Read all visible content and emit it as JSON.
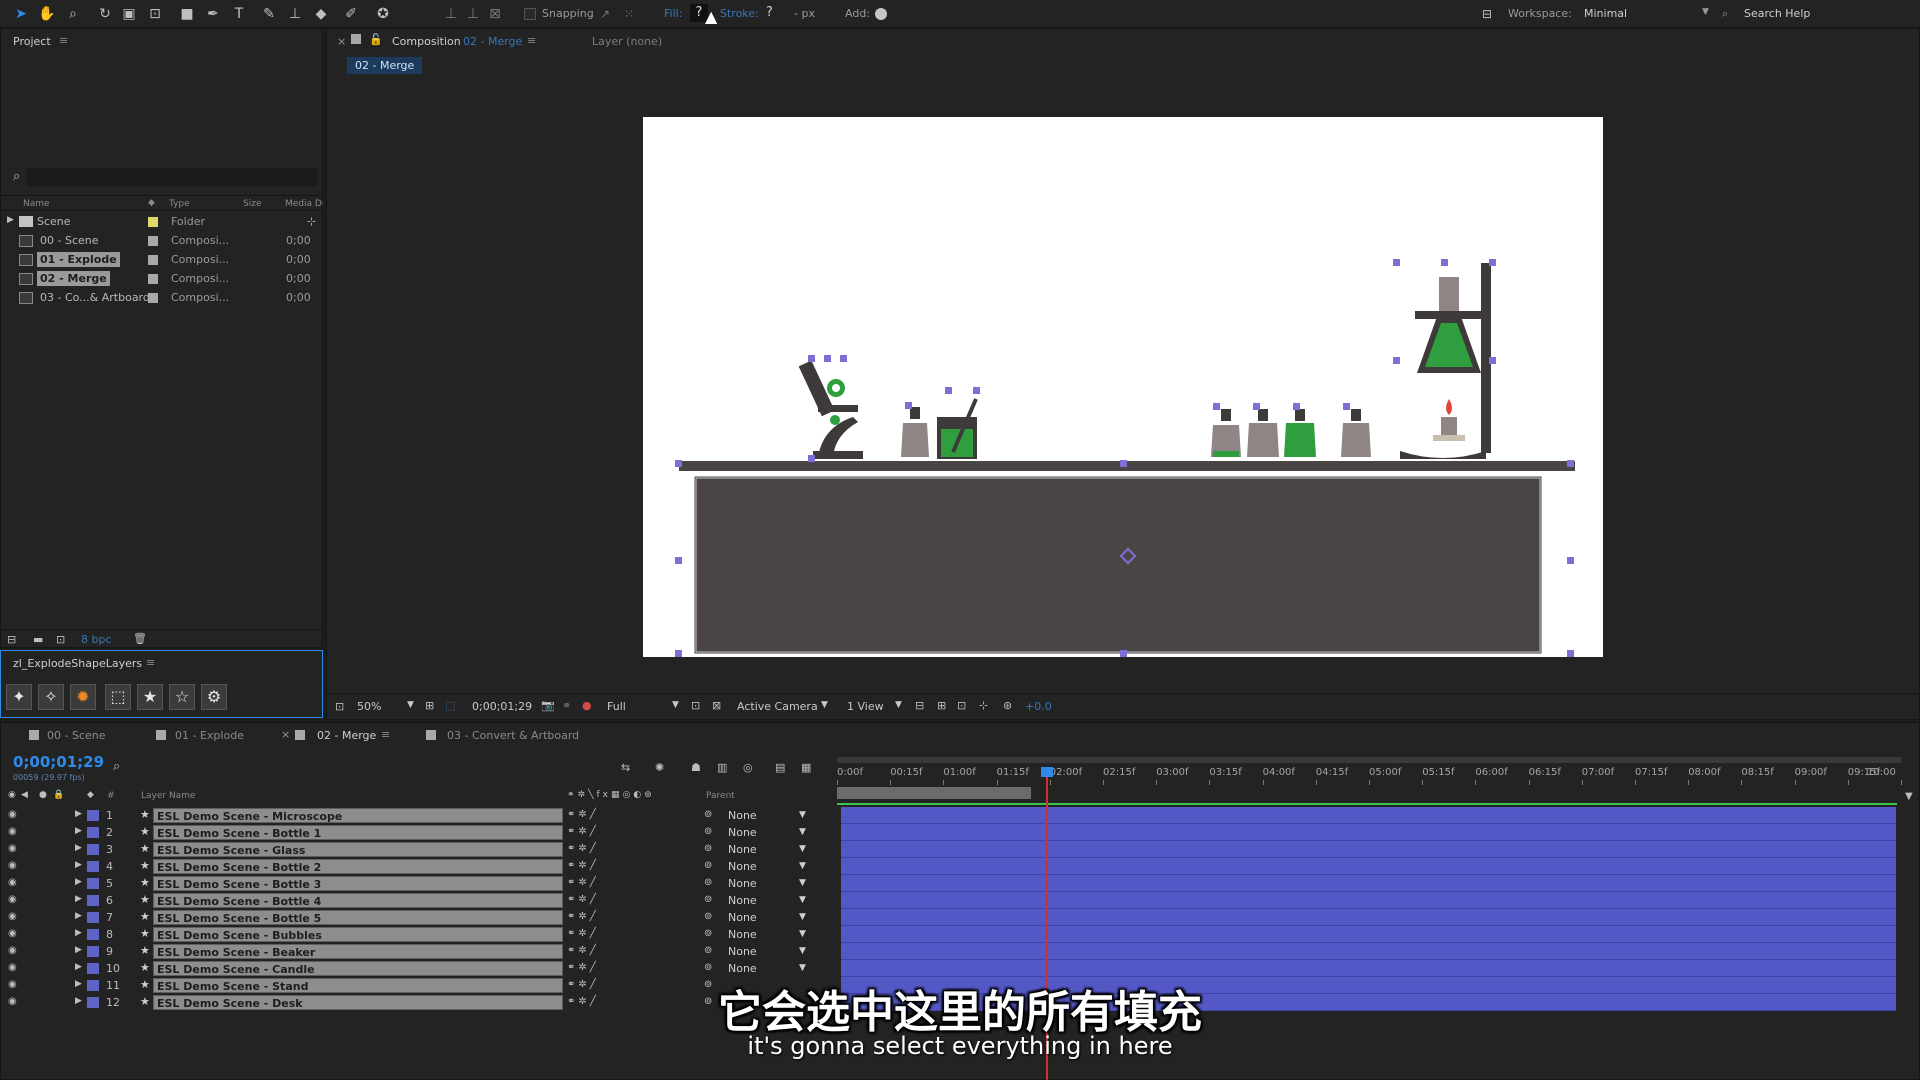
{
  "toolbar": {
    "snapping": "Snapping",
    "fill": "Fill:",
    "fill_value": "?",
    "stroke": "Stroke:",
    "stroke_value": "?",
    "px": "- px",
    "add": "Add:",
    "workspace_label": "Workspace:",
    "workspace_value": "Minimal",
    "search_help": "Search Help"
  },
  "project_panel": {
    "tab": "Project",
    "col_name": "Name",
    "col_type": "Type",
    "col_size": "Size",
    "col_media": "Media Du",
    "items": [
      {
        "name": "Scene",
        "type": "Folder",
        "dur": ""
      },
      {
        "name": "00 - Scene",
        "type": "Composi...",
        "dur": "0;00"
      },
      {
        "name": "01 - Explode",
        "type": "Composi...",
        "dur": "0;00"
      },
      {
        "name": "02 - Merge",
        "type": "Composi...",
        "dur": "0;00"
      },
      {
        "name": "03 - Co...& Artboard",
        "type": "Composi...",
        "dur": "0;00"
      }
    ],
    "bpc": "8 bpc"
  },
  "script_panel": {
    "tab": "zl_ExplodeShapeLayers"
  },
  "composition": {
    "tab_label": "Composition",
    "tab_name": "02 - Merge",
    "layer_tab": "Layer (none)",
    "breadcrumb": "02 - Merge",
    "zoom": "50%",
    "timecode": "0;00;01;29",
    "resolution": "Full",
    "camera": "Active Camera",
    "view": "1 View",
    "exposure": "+0.0"
  },
  "timeline": {
    "tabs": [
      "00 - Scene",
      "01 - Explode",
      "02 - Merge",
      "03 - Convert & Artboard"
    ],
    "timecode": "0;00;01;29",
    "fps": "00059 (29.97 fps)",
    "col_layer_name": "Layer Name",
    "col_parent": "Parent",
    "col_num": "#",
    "ruler": [
      "0:00f",
      "00:15f",
      "01:00f",
      "01:15f",
      "02:00f",
      "02:15f",
      "03:00f",
      "03:15f",
      "04:00f",
      "04:15f",
      "05:00f",
      "05:15f",
      "06:00f",
      "06:15f",
      "07:00f",
      "07:15f",
      "08:00f",
      "08:15f",
      "09:00f",
      "09:15f",
      "10:00"
    ],
    "layers": [
      {
        "num": "1",
        "name": "ESL Demo Scene - Microscope",
        "parent": "None"
      },
      {
        "num": "2",
        "name": "ESL Demo Scene - Bottle 1",
        "parent": "None"
      },
      {
        "num": "3",
        "name": "ESL Demo Scene - Glass",
        "parent": "None"
      },
      {
        "num": "4",
        "name": "ESL Demo Scene - Bottle 2",
        "parent": "None"
      },
      {
        "num": "5",
        "name": "ESL Demo Scene - Bottle 3",
        "parent": "None"
      },
      {
        "num": "6",
        "name": "ESL Demo Scene - Bottle 4",
        "parent": "None"
      },
      {
        "num": "7",
        "name": "ESL Demo Scene - Bottle 5",
        "parent": "None"
      },
      {
        "num": "8",
        "name": "ESL Demo Scene - Bubbles",
        "parent": "None"
      },
      {
        "num": "9",
        "name": "ESL Demo Scene - Beaker",
        "parent": "None"
      },
      {
        "num": "10",
        "name": "ESL Demo Scene - Candle",
        "parent": "None"
      },
      {
        "num": "11",
        "name": "ESL Demo Scene - Stand",
        "parent": "None"
      },
      {
        "num": "12",
        "name": "ESL Demo Scene - Desk",
        "parent": ""
      }
    ]
  },
  "subtitles": {
    "cn": "它会选中这里的所有填充",
    "en": "it's gonna select everything in here"
  },
  "colors": {
    "accent": "#2d8ceb",
    "layer_bar": "#5358c6",
    "selection_handle": "#7d6fd6",
    "playhead": "#d0312d",
    "flask_green": "#2e9e3e",
    "desk": "#4a4544"
  }
}
